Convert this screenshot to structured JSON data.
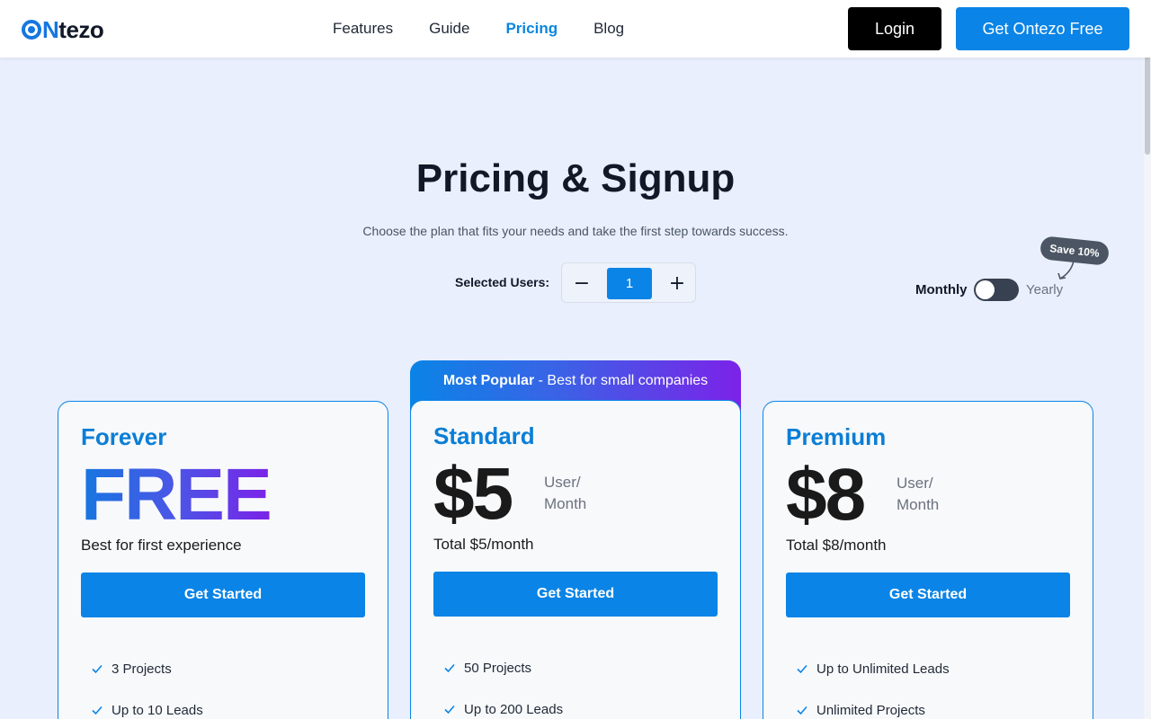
{
  "header": {
    "logo_o": "O",
    "logo_n": "N",
    "logo_rest": "tezo",
    "nav": [
      "Features",
      "Guide",
      "Pricing",
      "Blog"
    ],
    "active_nav": "Pricing",
    "login_label": "Login",
    "cta_label": "Get Ontezo Free"
  },
  "hero": {
    "title": "Pricing & Signup",
    "subtitle": "Choose the plan that fits your needs and take the first step towards success."
  },
  "users": {
    "label": "Selected Users:",
    "value": "1",
    "minus": "−",
    "plus": "+"
  },
  "billing": {
    "monthly": "Monthly",
    "yearly": "Yearly",
    "save_badge": "Save 10%",
    "yearly_selected": false
  },
  "popular": {
    "bold": "Most Popular",
    "rest": " - Best for small companies"
  },
  "plans": [
    {
      "name": "Forever",
      "price": "FREE",
      "desc": "Best for first experience",
      "button": "Get Started",
      "features": [
        "3 Projects",
        "Up to 10 Leads"
      ]
    },
    {
      "name": "Standard",
      "price": "$5",
      "unit_line1": "User/",
      "unit_line2": "Month",
      "desc": "Total $5/month",
      "button": "Get Started",
      "features": [
        "50 Projects",
        "Up to 200 Leads"
      ]
    },
    {
      "name": "Premium",
      "price": "$8",
      "unit_line1": "User/",
      "unit_line2": "Month",
      "desc": "Total $8/month",
      "button": "Get Started",
      "features": [
        "Up to Unlimited Leads",
        "Unlimited Projects"
      ]
    }
  ],
  "colors": {
    "accent": "#0a84e6",
    "background": "#e9effc",
    "gradient_start": "#1677e0",
    "gradient_end": "#7c22e8"
  }
}
